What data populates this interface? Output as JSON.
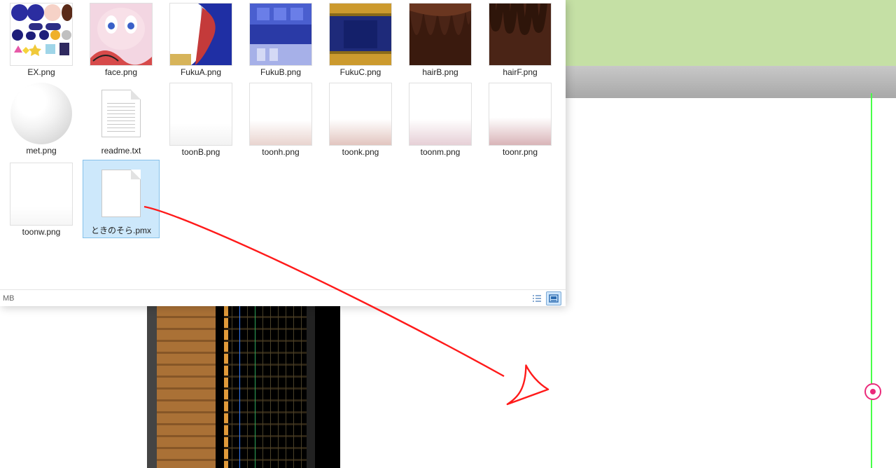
{
  "status_left": "MB",
  "files": [
    {
      "name": "EX.png"
    },
    {
      "name": "face.png"
    },
    {
      "name": "FukuA.png"
    },
    {
      "name": "FukuB.png"
    },
    {
      "name": "FukuC.png"
    },
    {
      "name": "hairB.png"
    },
    {
      "name": "hairF.png"
    },
    {
      "name": "met.png"
    },
    {
      "name": "readme.txt"
    },
    {
      "name": "toonB.png"
    },
    {
      "name": "toonh.png"
    },
    {
      "name": "toonk.png"
    },
    {
      "name": "toonm.png"
    },
    {
      "name": "toonr.png"
    },
    {
      "name": "toonw.png"
    },
    {
      "name": "ときのそら.pmx"
    }
  ]
}
